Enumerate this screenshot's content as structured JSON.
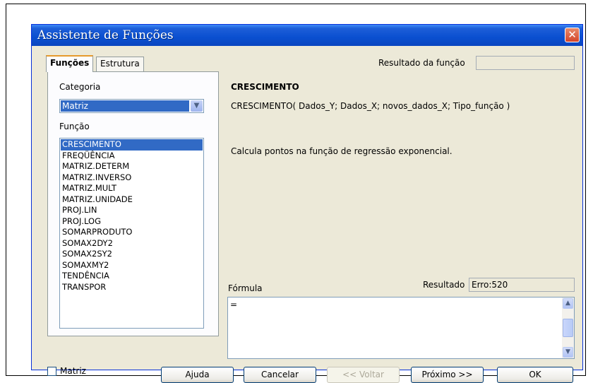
{
  "window": {
    "title": "Assistente de Funções",
    "close_glyph": "✕"
  },
  "tabs": [
    "Funções",
    "Estrutura"
  ],
  "left": {
    "category_label": "Categoria",
    "category_value": "Matriz",
    "function_label": "Função",
    "functions": [
      "CRESCIMENTO",
      "FREQÜÊNCIA",
      "MATRIZ.DETERM",
      "MATRIZ.INVERSO",
      "MATRIZ.MULT",
      "MATRIZ.UNIDADE",
      "PROJ.LIN",
      "PROJ.LOG",
      "SOMARPRODUTO",
      "SOMAX2DY2",
      "SOMAX2SY2",
      "SOMAXMY2",
      "TENDÊNCIA",
      "TRANSPOR"
    ],
    "selected_index": 0
  },
  "right": {
    "result_label": "Resultado da função",
    "result_value": "",
    "function_name": "CRESCIMENTO",
    "syntax": "CRESCIMENTO( Dados_Y; Dados_X; novos_dados_X; Tipo_função )",
    "description": "Calcula pontos na função de regressão exponencial.",
    "formula_label": "Fórmula",
    "result2_label": "Resultado",
    "result2_value": "Erro:520",
    "formula_value": "="
  },
  "bottom": {
    "matrix_checkbox_label": "Matriz",
    "matrix_checked": false,
    "buttons": {
      "help": "Ajuda",
      "cancel": "Cancelar",
      "back": "<< Voltar",
      "next": "Próximo >>",
      "ok": "OK"
    }
  },
  "colors": {
    "titlebar": "#0a4fd0",
    "selection": "#316ac5",
    "dialog_bg": "#ece9d8",
    "close_button": "#d4452a"
  },
  "icons": [
    "close-icon",
    "chevron-down-icon",
    "scroll-up-icon",
    "scroll-down-icon"
  ]
}
